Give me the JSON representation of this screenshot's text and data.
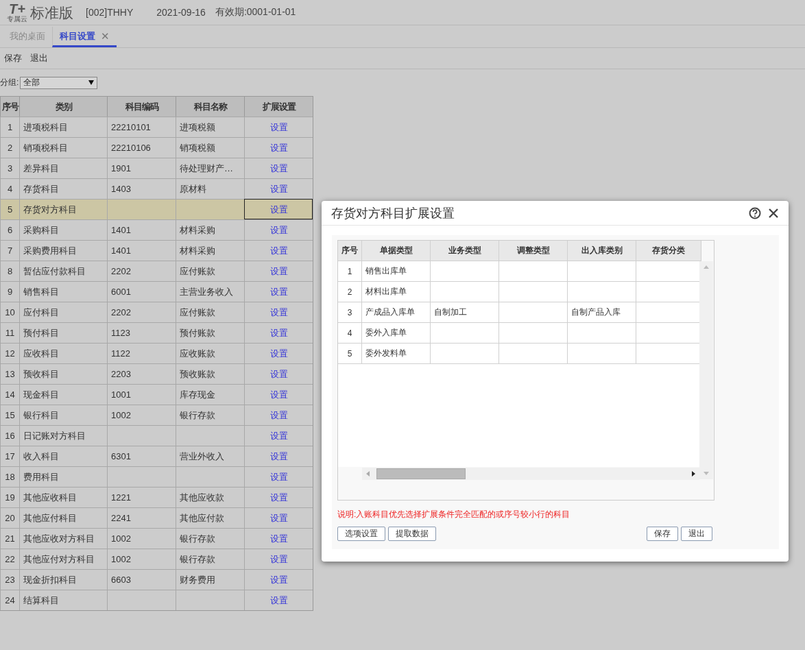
{
  "header": {
    "logo_mark": "T+",
    "logo_sub": "专属云",
    "edition": "标准版",
    "account": "[002]THHY",
    "date": "2021-09-16",
    "validity": "有效期:0001-01-01"
  },
  "tabs": [
    {
      "label": "我的桌面",
      "selected": false
    },
    {
      "label": "科目设置",
      "selected": true,
      "close": "✕"
    }
  ],
  "toolbar": [
    "保存",
    "退出"
  ],
  "filter": {
    "label": "分组:",
    "value": "全部"
  },
  "table": {
    "columns": [
      "序号",
      "类别",
      "科目编码",
      "科目名称",
      "扩展设置"
    ],
    "rows": [
      {
        "no": "1",
        "category": "进项税科目",
        "code": "22210101",
        "name": "进项税额",
        "action": "设置",
        "selected": false
      },
      {
        "no": "2",
        "category": "销项税科目",
        "code": "22210106",
        "name": "销项税额",
        "action": "设置",
        "selected": false
      },
      {
        "no": "3",
        "category": "差异科目",
        "code": "1901",
        "name": "待处理财产…",
        "action": "设置",
        "selected": false
      },
      {
        "no": "4",
        "category": "存货科目",
        "code": "1403",
        "name": "原材料",
        "action": "设置",
        "selected": false
      },
      {
        "no": "5",
        "category": "存货对方科目",
        "code": "",
        "name": "",
        "action": "设置",
        "selected": true
      },
      {
        "no": "6",
        "category": "采购科目",
        "code": "1401",
        "name": "材料采购",
        "action": "设置",
        "selected": false
      },
      {
        "no": "7",
        "category": "采购费用科目",
        "code": "1401",
        "name": "材料采购",
        "action": "设置",
        "selected": false
      },
      {
        "no": "8",
        "category": "暂估应付款科目",
        "code": "2202",
        "name": "应付账款",
        "action": "设置",
        "selected": false
      },
      {
        "no": "9",
        "category": "销售科目",
        "code": "6001",
        "name": "主营业务收入",
        "action": "设置",
        "selected": false
      },
      {
        "no": "10",
        "category": "应付科目",
        "code": "2202",
        "name": "应付账款",
        "action": "设置",
        "selected": false
      },
      {
        "no": "11",
        "category": "预付科目",
        "code": "1123",
        "name": "预付账款",
        "action": "设置",
        "selected": false
      },
      {
        "no": "12",
        "category": "应收科目",
        "code": "1122",
        "name": "应收账款",
        "action": "设置",
        "selected": false
      },
      {
        "no": "13",
        "category": "预收科目",
        "code": "2203",
        "name": "预收账款",
        "action": "设置",
        "selected": false
      },
      {
        "no": "14",
        "category": "现金科目",
        "code": "1001",
        "name": "库存现金",
        "action": "设置",
        "selected": false
      },
      {
        "no": "15",
        "category": "银行科目",
        "code": "1002",
        "name": "银行存款",
        "action": "设置",
        "selected": false
      },
      {
        "no": "16",
        "category": "日记账对方科目",
        "code": "",
        "name": "",
        "action": "设置",
        "selected": false
      },
      {
        "no": "17",
        "category": "收入科目",
        "code": "6301",
        "name": "营业外收入",
        "action": "设置",
        "selected": false
      },
      {
        "no": "18",
        "category": "费用科目",
        "code": "",
        "name": "",
        "action": "设置",
        "selected": false
      },
      {
        "no": "19",
        "category": "其他应收科目",
        "code": "1221",
        "name": "其他应收款",
        "action": "设置",
        "selected": false
      },
      {
        "no": "20",
        "category": "其他应付科目",
        "code": "2241",
        "name": "其他应付款",
        "action": "设置",
        "selected": false
      },
      {
        "no": "21",
        "category": "其他应收对方科目",
        "code": "1002",
        "name": "银行存款",
        "action": "设置",
        "selected": false
      },
      {
        "no": "22",
        "category": "其他应付对方科目",
        "code": "1002",
        "name": "银行存款",
        "action": "设置",
        "selected": false
      },
      {
        "no": "23",
        "category": "现金折扣科目",
        "code": "6603",
        "name": "财务费用",
        "action": "设置",
        "selected": false
      },
      {
        "no": "24",
        "category": "结算科目",
        "code": "",
        "name": "",
        "action": "设置",
        "selected": false
      }
    ]
  },
  "dialog": {
    "title": "存货对方科目扩展设置",
    "grid": {
      "columns": [
        "序号",
        "单据类型",
        "业务类型",
        "调整类型",
        "出入库类别",
        "存货分类"
      ],
      "rows": [
        [
          "1",
          "销售出库单",
          "",
          "",
          "",
          ""
        ],
        [
          "2",
          "材料出库单",
          "",
          "",
          "",
          ""
        ],
        [
          "3",
          "产成品入库单",
          "自制加工",
          "",
          "自制产品入库",
          ""
        ],
        [
          "4",
          "委外入库单",
          "",
          "",
          "",
          ""
        ],
        [
          "5",
          "委外发料单",
          "",
          "",
          "",
          ""
        ]
      ]
    },
    "note": "说明:入账科目优先选择扩展条件完全匹配的或序号较小行的科目",
    "left_buttons": [
      "选项设置",
      "提取数据"
    ],
    "right_buttons": [
      "保存",
      "退出"
    ]
  }
}
